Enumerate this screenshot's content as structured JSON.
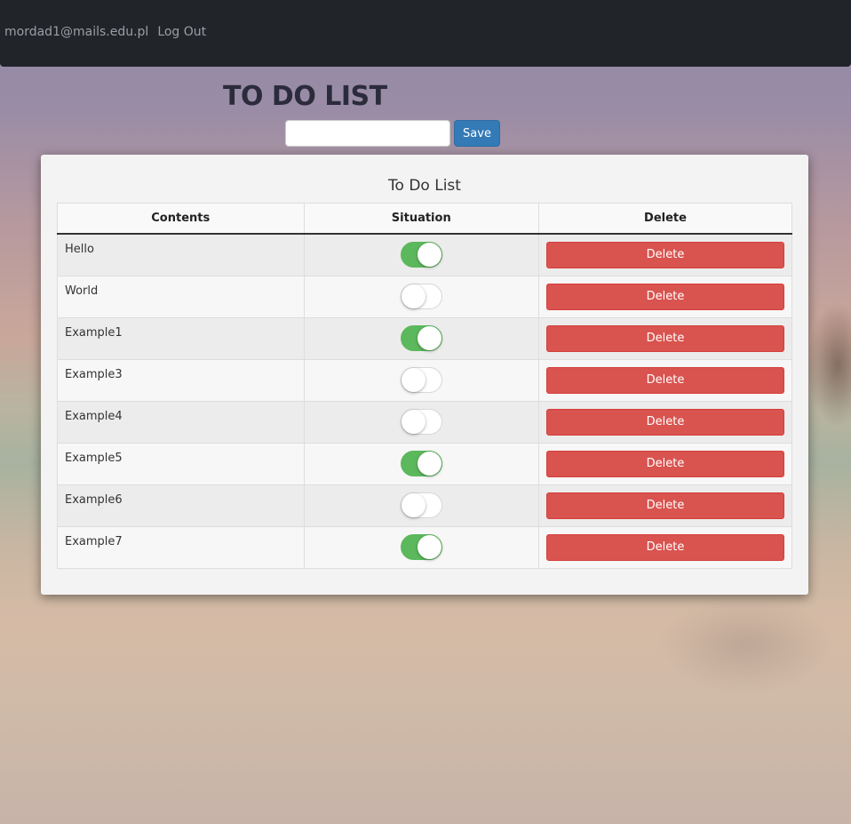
{
  "navbar": {
    "user_email": "mordad1@mails.edu.pl",
    "logout_label": "Log Out"
  },
  "page": {
    "title": "TO DO LIST"
  },
  "form": {
    "input_value": "",
    "save_label": "Save"
  },
  "panel": {
    "title": "To Do List"
  },
  "table": {
    "headers": [
      "Contents",
      "Situation",
      "Delete"
    ],
    "rows": [
      {
        "content": "Hello",
        "done": true,
        "delete_label": "Delete"
      },
      {
        "content": "World",
        "done": false,
        "delete_label": "Delete"
      },
      {
        "content": "Example1",
        "done": true,
        "delete_label": "Delete"
      },
      {
        "content": "Example3",
        "done": false,
        "delete_label": "Delete"
      },
      {
        "content": "Example4",
        "done": false,
        "delete_label": "Delete"
      },
      {
        "content": "Example5",
        "done": true,
        "delete_label": "Delete"
      },
      {
        "content": "Example6",
        "done": false,
        "delete_label": "Delete"
      },
      {
        "content": "Example7",
        "done": true,
        "delete_label": "Delete"
      }
    ]
  },
  "colors": {
    "navbar": "#212429",
    "save": "#337ab7",
    "delete": "#d9534f",
    "toggle_on": "#5cb85c"
  }
}
